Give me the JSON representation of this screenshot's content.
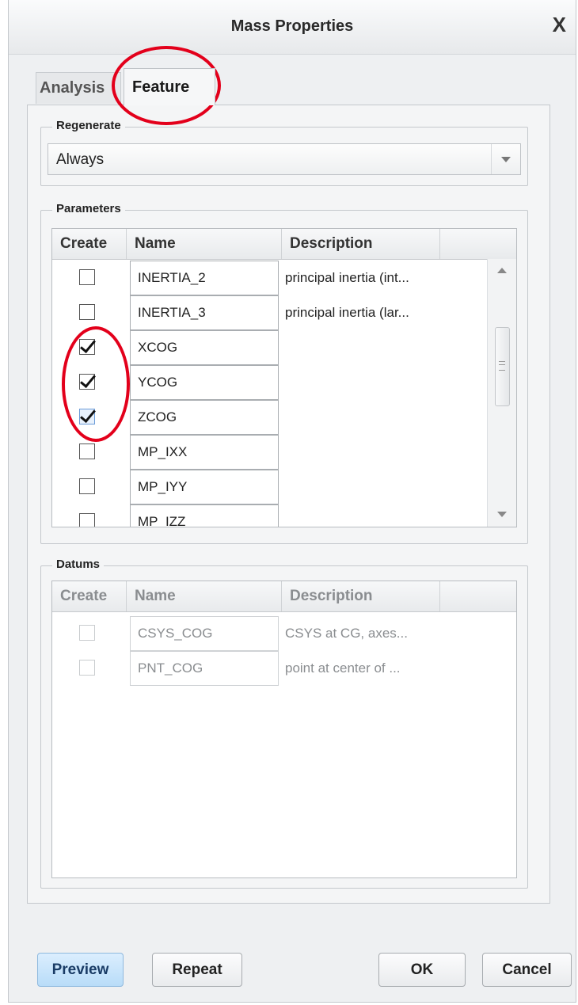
{
  "window": {
    "title": "Mass Properties",
    "close_glyph": "X"
  },
  "tabs": [
    {
      "label": "Analysis",
      "active": false
    },
    {
      "label": "Feature",
      "active": true
    }
  ],
  "regenerate": {
    "label": "Regenerate",
    "value": "Always"
  },
  "parameters": {
    "label": "Parameters",
    "columns": [
      "Create",
      "Name",
      "Description"
    ],
    "rows": [
      {
        "checked": false,
        "name": "INERTIA_2",
        "description": "principal inertia (int..."
      },
      {
        "checked": false,
        "name": "INERTIA_3",
        "description": "principal inertia (lar..."
      },
      {
        "checked": true,
        "name": "XCOG",
        "description": ""
      },
      {
        "checked": true,
        "name": "YCOG",
        "description": ""
      },
      {
        "checked": true,
        "name": "ZCOG",
        "description": ""
      },
      {
        "checked": false,
        "name": "MP_IXX",
        "description": ""
      },
      {
        "checked": false,
        "name": "MP_IYY",
        "description": ""
      },
      {
        "checked": false,
        "name": "MP_IZZ",
        "description": ""
      }
    ]
  },
  "datums": {
    "label": "Datums",
    "columns": [
      "Create",
      "Name",
      "Description"
    ],
    "rows": [
      {
        "checked": false,
        "name": "CSYS_COG",
        "description": "CSYS at CG, axes..."
      },
      {
        "checked": false,
        "name": "PNT_COG",
        "description": "point at center of ..."
      }
    ]
  },
  "buttons": {
    "preview": "Preview",
    "repeat": "Repeat",
    "ok": "OK",
    "cancel": "Cancel"
  },
  "colors": {
    "annotation": "#e3001b",
    "preview_button": "#b8dcf8"
  },
  "icons": {
    "close": "close-icon",
    "dropdown": "chevron-down-icon",
    "check": "check-icon"
  }
}
